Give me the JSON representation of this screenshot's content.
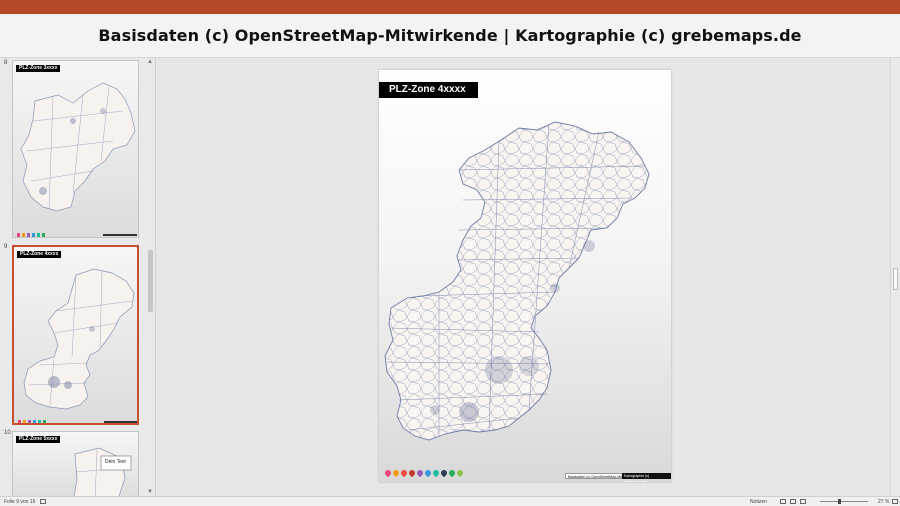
{
  "banner": {
    "text": "Basisdaten (c) OpenStreetMap-Mitwirkende | Kartographie (c) grebemaps.de"
  },
  "thumbnails": [
    {
      "number": "8",
      "title": "PLZ-Zone 3xxxx",
      "selected": false
    },
    {
      "number": "9",
      "title": "PLZ-Zone 4xxxx",
      "selected": true
    },
    {
      "number": "10",
      "title": "PLZ-Zone 5xxxx",
      "selected": false
    }
  ],
  "slide": {
    "title": "PLZ-Zone 4xxxx",
    "credit_left": "Basisdaten (c) OpenStreetMap-Mitwirkende",
    "credit_right": "Kartographie (c) grebemaps.de",
    "pin_colors": [
      "#e8467c",
      "#f39c12",
      "#e74c3c",
      "#c0392b",
      "#9b59b6",
      "#3498db",
      "#1abc9c",
      "#2c3e50",
      "#27ae60",
      "#8bc34a"
    ]
  },
  "thumb_callout": {
    "text": "Dein Text"
  },
  "statusbar": {
    "slide_info": "Folie 9 von 16",
    "notes_label": "Notizen",
    "zoom": "27 %"
  },
  "colors": {
    "accent": "#b7472a",
    "map_fill": "#faf5f1",
    "map_stroke": "#6b7aa6"
  }
}
